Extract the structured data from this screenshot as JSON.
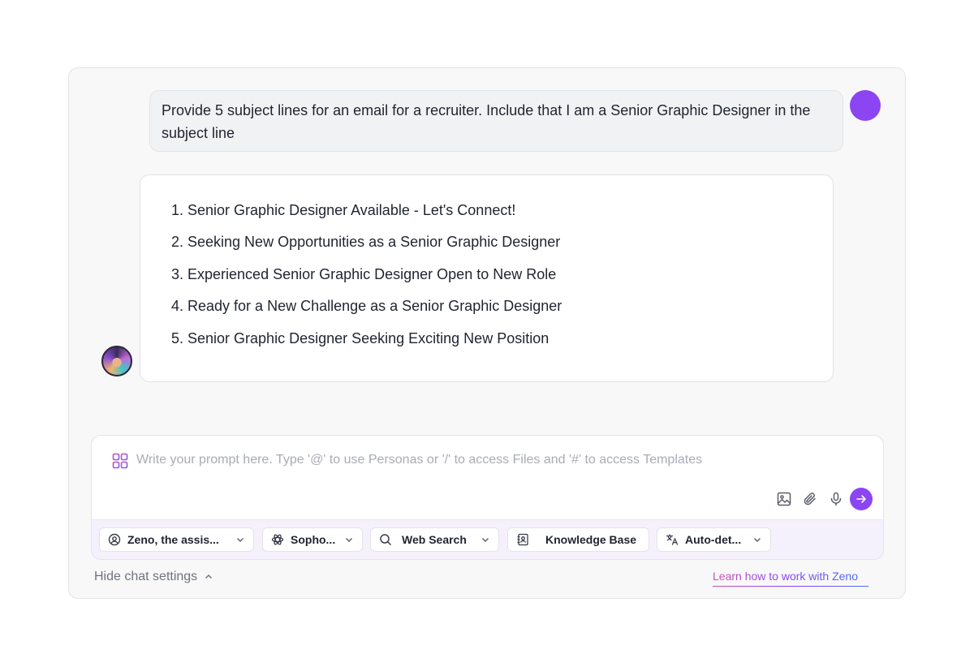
{
  "conversation": {
    "user_message": "Provide 5 subject lines for an email for a recruiter. Include that I am a Senior Graphic Designer in the subject line",
    "assistant_items": [
      "1. Senior Graphic Designer Available - Let's Connect!",
      "2. Seeking New Opportunities as a Senior Graphic Designer",
      "3. Experienced Senior Graphic Designer Open to New Role",
      "4. Ready for a New Challenge as a Senior Graphic Designer",
      "5. Senior Graphic Designer Seeking Exciting New Position"
    ]
  },
  "composer": {
    "placeholder": "Write your prompt here. Type '@' to use Personas or '/' to access Files and '#' to access Templates",
    "value": "",
    "tools": [
      "image-icon",
      "paperclip-icon",
      "microphone-icon",
      "send-icon"
    ]
  },
  "chips": [
    {
      "label": "Zeno, the assis...",
      "icon": "persona-icon"
    },
    {
      "label": "Sopho...",
      "icon": "model-icon"
    },
    {
      "label": "Web Search",
      "icon": "search-icon"
    },
    {
      "label": "Knowledge Base",
      "icon": "contacts-book-icon"
    },
    {
      "label": "Auto-det...",
      "icon": "translate-icon"
    }
  ],
  "footer": {
    "hide_settings_label": "Hide chat settings",
    "learn_link_label": "Learn how to work with Zeno"
  },
  "colors": {
    "accent": "#8b45f3",
    "user_avatar": "#8b45f3"
  }
}
